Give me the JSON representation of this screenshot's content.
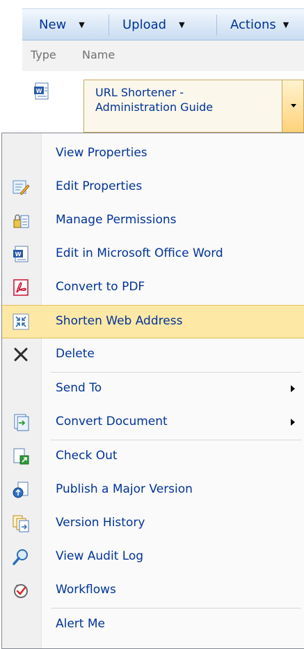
{
  "toolbar": {
    "new_label": "New",
    "upload_label": "Upload",
    "actions_label": "Actions"
  },
  "columns": {
    "type": "Type",
    "name": "Name"
  },
  "item": {
    "title_line1": "URL Shortener -",
    "title_line2": "Administration Guide",
    "icon": "word-document-icon"
  },
  "menu": {
    "items": [
      {
        "label": "View Properties",
        "icon": ""
      },
      {
        "label": "Edit Properties",
        "icon": "edit-properties-icon"
      },
      {
        "label": "Manage Permissions",
        "icon": "manage-permissions-icon"
      },
      {
        "label": "Edit in Microsoft Office Word",
        "icon": "word-document-icon"
      },
      {
        "label": "Convert to PDF",
        "icon": "pdf-icon"
      },
      {
        "label": "Shorten Web Address",
        "icon": "shorten-url-icon",
        "highlighted": true
      },
      {
        "label": "Delete",
        "icon": "delete-x-icon"
      },
      {
        "label": "Send To",
        "icon": "",
        "submenu": true
      },
      {
        "label": "Convert Document",
        "icon": "convert-document-icon",
        "submenu": true
      },
      {
        "label": "Check Out",
        "icon": "check-out-icon"
      },
      {
        "label": "Publish a Major Version",
        "icon": "publish-icon"
      },
      {
        "label": "Version History",
        "icon": "version-history-icon"
      },
      {
        "label": "View Audit Log",
        "icon": "magnifier-icon"
      },
      {
        "label": "Workflows",
        "icon": "workflows-icon"
      },
      {
        "label": "Alert Me",
        "icon": ""
      }
    ]
  },
  "colors": {
    "link": "#003399",
    "highlight": "#fde8a6",
    "toolbar": "#dbe8f7"
  }
}
